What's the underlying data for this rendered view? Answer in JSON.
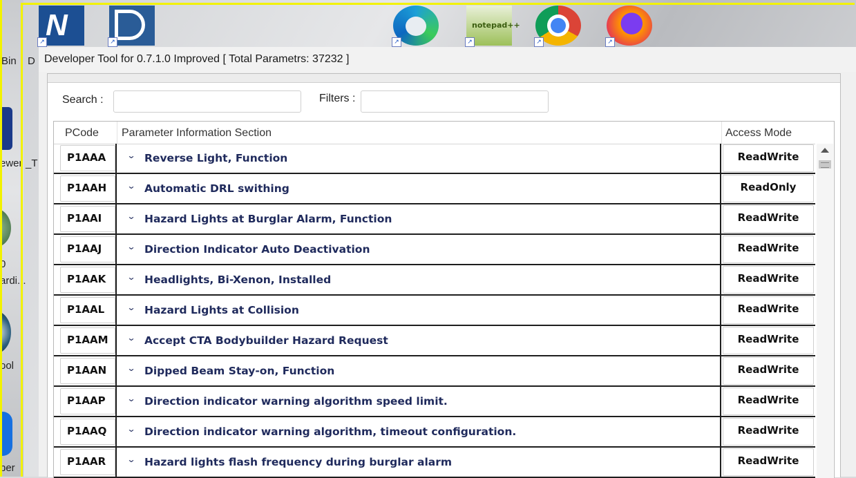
{
  "desktop": {
    "left_labels": [
      "Bin",
      "D",
      "ewer",
      "_T",
      "0",
      "ardi...",
      "ool",
      "per"
    ]
  },
  "taskbar_icons": [
    "n-app-icon",
    "d-app-icon",
    "edge-icon",
    "notepadpp-icon",
    "chrome-icon",
    "firefox-icon"
  ],
  "window": {
    "title": "Developer Tool for 0.7.1.0 Improved [ Total Parametrs: 37232 ]"
  },
  "search": {
    "label": "Search :",
    "value": ""
  },
  "filters": {
    "label": "Filters :",
    "value": ""
  },
  "table": {
    "headers": [
      "PCode",
      "Parameter Information Section",
      "Access Mode"
    ],
    "rows": [
      {
        "pcode": "P1AAA",
        "info": "Reverse Light, Function",
        "mode": "ReadWrite"
      },
      {
        "pcode": "P1AAH",
        "info": "Automatic DRL swithing",
        "mode": "ReadOnly"
      },
      {
        "pcode": "P1AAI",
        "info": "Hazard Lights at Burglar Alarm, Function",
        "mode": "ReadWrite"
      },
      {
        "pcode": "P1AAJ",
        "info": "Direction Indicator Auto Deactivation",
        "mode": "ReadWrite"
      },
      {
        "pcode": "P1AAK",
        "info": "Headlights, Bi-Xenon, Installed",
        "mode": "ReadWrite"
      },
      {
        "pcode": "P1AAL",
        "info": "Hazard Lights at Collision",
        "mode": "ReadWrite"
      },
      {
        "pcode": "P1AAM",
        "info": "Accept CTA Bodybuilder Hazard Request",
        "mode": "ReadWrite"
      },
      {
        "pcode": "P1AAN",
        "info": "Dipped Beam Stay-on, Function",
        "mode": "ReadWrite"
      },
      {
        "pcode": "P1AAP",
        "info": "Direction indicator warning algorithm speed limit.",
        "mode": "ReadWrite"
      },
      {
        "pcode": "P1AAQ",
        "info": "Direction indicator warning algorithm, timeout configuration.",
        "mode": "ReadWrite"
      },
      {
        "pcode": "P1AAR",
        "info": "Hazard lights flash frequency during burglar alarm",
        "mode": "ReadWrite"
      }
    ]
  },
  "colors": {
    "info_text": "#1f2a5c",
    "frame_highlight": "#f2f200"
  }
}
